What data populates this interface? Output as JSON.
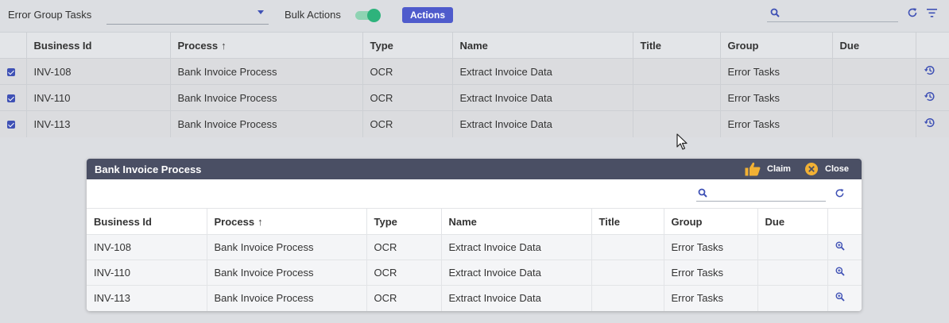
{
  "toolbar": {
    "error_group_label": "Error Group Tasks",
    "error_group_value": "",
    "bulk_actions_label": "Bulk Actions",
    "actions_button": "Actions",
    "search_placeholder": "",
    "search_value": ""
  },
  "main_table": {
    "columns": [
      "Business Id",
      "Process",
      "Type",
      "Name",
      "Title",
      "Group",
      "Due"
    ],
    "sort_arrow": "↑",
    "rows": [
      {
        "business_id": "INV-108",
        "process": "Bank Invoice Process",
        "type": "OCR",
        "name": "Extract Invoice Data",
        "title": "",
        "group": "Error Tasks",
        "due": ""
      },
      {
        "business_id": "INV-110",
        "process": "Bank Invoice Process",
        "type": "OCR",
        "name": "Extract Invoice Data",
        "title": "",
        "group": "Error Tasks",
        "due": ""
      },
      {
        "business_id": "INV-113",
        "process": "Bank Invoice Process",
        "type": "OCR",
        "name": "Extract Invoice Data",
        "title": "",
        "group": "Error Tasks",
        "due": ""
      }
    ]
  },
  "dialog": {
    "title": "Bank Invoice Process",
    "claim_label": "Claim",
    "close_label": "Close",
    "search_value": "",
    "columns": [
      "Business Id",
      "Process",
      "Type",
      "Name",
      "Title",
      "Group",
      "Due"
    ],
    "sort_arrow": "↑",
    "rows": [
      {
        "business_id": "INV-108",
        "process": "Bank Invoice Process",
        "type": "OCR",
        "name": "Extract Invoice Data",
        "title": "",
        "group": "Error Tasks",
        "due": ""
      },
      {
        "business_id": "INV-110",
        "process": "Bank Invoice Process",
        "type": "OCR",
        "name": "Extract Invoice Data",
        "title": "",
        "group": "Error Tasks",
        "due": ""
      },
      {
        "business_id": "INV-113",
        "process": "Bank Invoice Process",
        "type": "OCR",
        "name": "Extract Invoice Data",
        "title": "",
        "group": "Error Tasks",
        "due": ""
      }
    ]
  },
  "colors": {
    "accent": "#3f51b5",
    "actions_button": "#4f5bcc",
    "toggle_on": "#2eb37c",
    "dialog_header": "#4a4f64",
    "claim_icon": "#f2b134",
    "close_icon": "#f2b134"
  },
  "icons": {
    "row_action": "history-icon",
    "dialog_row_action": "zoom-in-icon",
    "refresh": "refresh-icon",
    "filter": "filter-icon",
    "search": "search-icon",
    "claim": "thumbs-up-icon",
    "close": "close-circle-icon"
  }
}
